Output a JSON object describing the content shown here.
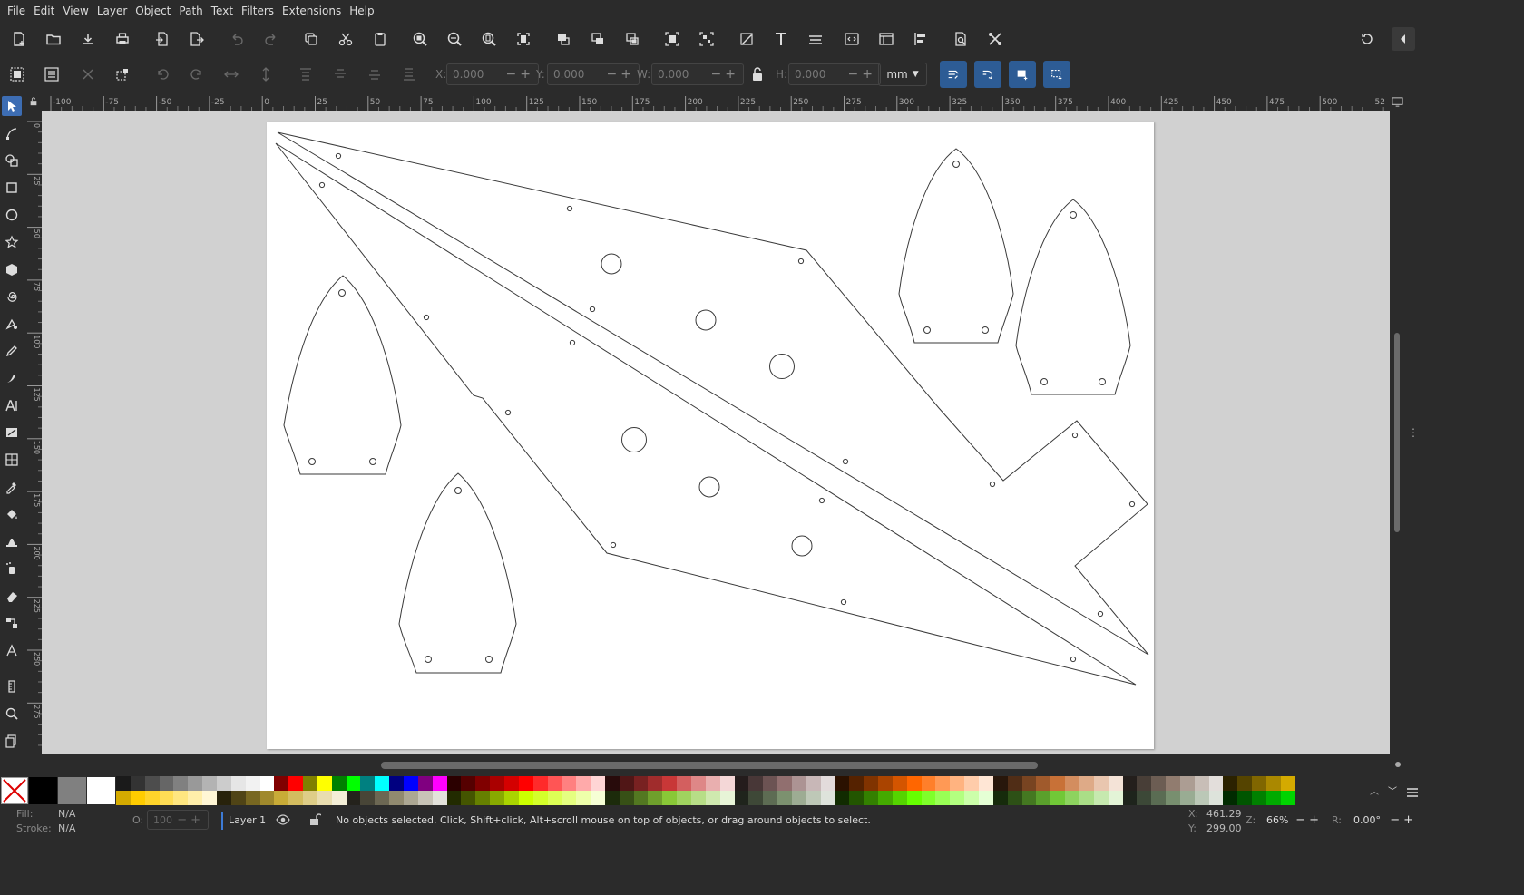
{
  "menu": [
    "File",
    "Edit",
    "View",
    "Layer",
    "Object",
    "Path",
    "Text",
    "Filters",
    "Extensions",
    "Help"
  ],
  "controls": {
    "x_label": "X:",
    "x_value": "0.000",
    "y_label": "Y:",
    "y_value": "0.000",
    "w_label": "W:",
    "w_value": "0.000",
    "h_label": "H:",
    "h_value": "0.000",
    "unit": "mm"
  },
  "ruler": {
    "h_labels": [
      "-100",
      "-75",
      "-50",
      "-25",
      "0",
      "25",
      "50",
      "75",
      "100",
      "125",
      "150",
      "175",
      "200",
      "225",
      "250",
      "275",
      "300",
      "325",
      "350",
      "375",
      "400",
      "425",
      "450",
      "475",
      "500",
      "52"
    ],
    "v_labels": [
      "0",
      "25",
      "50",
      "75",
      "100",
      "125",
      "150",
      "175",
      "200",
      "225",
      "250",
      "275"
    ]
  },
  "status": {
    "fill_label": "Fill:",
    "fill_value": "N/A",
    "stroke_label": "Stroke:",
    "stroke_value": "N/A",
    "opacity_label": "O:",
    "opacity_value": "100",
    "layer": "Layer 1",
    "message": "No objects selected. Click, Shift+click, Alt+scroll mouse on top of objects, or drag around objects to select.",
    "cursor_x_label": "X:",
    "cursor_x": "461.29",
    "cursor_y_label": "Y:",
    "cursor_y": "299.00",
    "zoom_label": "Z:",
    "zoom": "66%",
    "rotation_label": "R:",
    "rotation": "0.00°"
  },
  "colors": {
    "accent": "#3d6db3",
    "snap_button": "#2d5c95",
    "canvas_bg": "#d1d1d1",
    "page_bg": "#ffffff",
    "ui_bg": "#2b2b2b",
    "palette": [
      "#1a1a1a",
      "#333333",
      "#4d4d4d",
      "#666666",
      "#808080",
      "#999999",
      "#b3b3b3",
      "#cccccc",
      "#e6e6e6",
      "#f2f2f2",
      "#ffffff",
      "#800000",
      "#ff0000",
      "#808000",
      "#ffff00",
      "#008000",
      "#00ff00",
      "#008080",
      "#00ffff",
      "#000080",
      "#0000ff",
      "#800080",
      "#ff00ff",
      "#2b0000",
      "#550000",
      "#800000",
      "#aa0000",
      "#d40000",
      "#ff0000",
      "#ff2a2a",
      "#ff5555",
      "#ff8080",
      "#ffaaaa",
      "#ffd5d5",
      "#280b0b",
      "#501616",
      "#782121",
      "#a02c2c",
      "#c83737",
      "#d35f5f",
      "#de8787",
      "#e9afaf",
      "#f4d7d7",
      "#241c1c",
      "#483737",
      "#6c5353",
      "#916f6f",
      "#ac9393",
      "#c8b7b7",
      "#e3dbdb",
      "#2b1100",
      "#552200",
      "#803300",
      "#aa4400",
      "#d45500",
      "#ff6600",
      "#ff7f2a",
      "#ff9955",
      "#ffb380",
      "#ffccaa",
      "#ffe6d5",
      "#28170b",
      "#502d16",
      "#784421",
      "#a05a2c",
      "#c87137",
      "#d38d5f",
      "#deaa87",
      "#e9c6af",
      "#f4e3d7",
      "#241f1c",
      "#483e37",
      "#6c5d53",
      "#917c6f",
      "#ac9d93",
      "#c8beb7",
      "#e3dedb",
      "#2b2200",
      "#554400",
      "#806600",
      "#aa8800",
      "#d4aa00"
    ],
    "palette_row2": [
      "#d4aa00",
      "#ffcc00",
      "#ffd42a",
      "#ffdd55",
      "#ffe680",
      "#ffeeaa",
      "#fff6d5",
      "#28220b",
      "#504416",
      "#786721",
      "#a0892c",
      "#c8ab37",
      "#d3bc5f",
      "#decd87",
      "#e9ddaf",
      "#f4eed7",
      "#24221c",
      "#484537",
      "#6c6753",
      "#918a6f",
      "#aca793",
      "#c8c4b7",
      "#e3e2db",
      "#222b00",
      "#445500",
      "#668000",
      "#88aa00",
      "#aad400",
      "#ccff00",
      "#d4ff2a",
      "#ddff55",
      "#e5ff80",
      "#eeffaa",
      "#f6ffd5",
      "#1c2b0b",
      "#375016",
      "#537821",
      "#6fa02c",
      "#89c837",
      "#a0d35f",
      "#b7de87",
      "#cfe9af",
      "#e7f4d7",
      "#1f241c",
      "#3e4837",
      "#5d6c53",
      "#7c916f",
      "#9dac93",
      "#bec8b7",
      "#dee3db",
      "#112b00",
      "#225500",
      "#338000",
      "#44aa00",
      "#55d400",
      "#66ff00",
      "#7fff2a",
      "#99ff55",
      "#b3ff80",
      "#ccffaa",
      "#e5ffd5",
      "#162b0b",
      "#2d5016",
      "#447821",
      "#5aa02c",
      "#71c837",
      "#8dd35f",
      "#aade87",
      "#c6e9af",
      "#e3f4d7",
      "#1e241c",
      "#3c4837",
      "#5a6c53",
      "#788f6f",
      "#99ac93",
      "#bbc8b7",
      "#dde3db",
      "#002b00",
      "#005500",
      "#008000",
      "#00aa00",
      "#00d400"
    ]
  }
}
